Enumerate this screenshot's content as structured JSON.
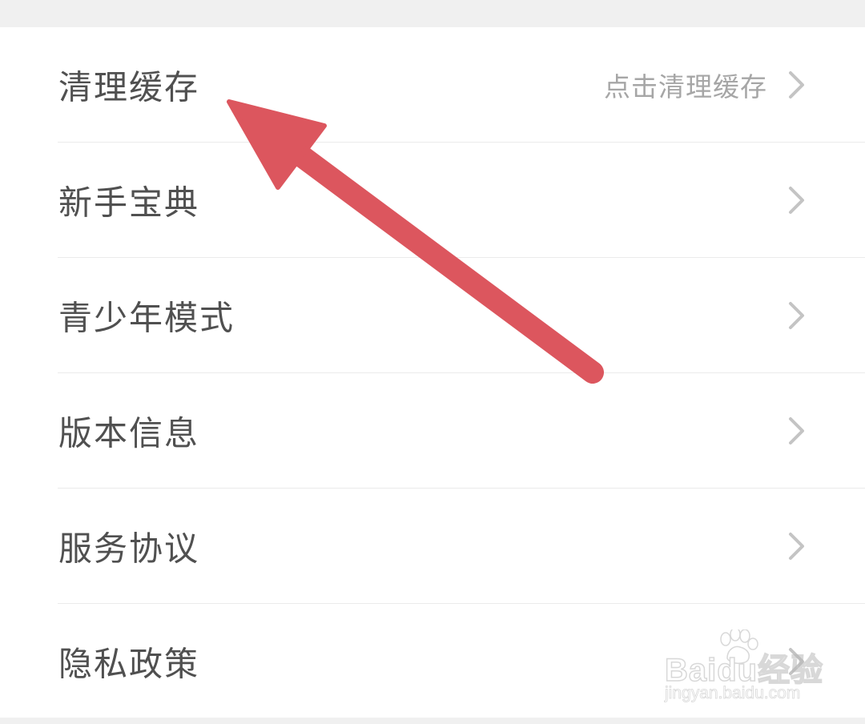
{
  "settings": {
    "items": [
      {
        "label": "清理缓存",
        "value": "点击清理缓存"
      },
      {
        "label": "新手宝典",
        "value": ""
      },
      {
        "label": "青少年模式",
        "value": ""
      },
      {
        "label": "版本信息",
        "value": ""
      },
      {
        "label": "服务协议",
        "value": ""
      },
      {
        "label": "隐私政策",
        "value": ""
      }
    ]
  },
  "icons": {
    "row_chevron": "chevron-right-icon",
    "annotation": "red-arrow-annotation"
  },
  "watermark": {
    "brand": "Baidu经验",
    "url": "jingyan.baidu.com"
  },
  "colors": {
    "background": "#f0f0f0",
    "card": "#ffffff",
    "label_text": "#505050",
    "value_text": "#a6a6a6",
    "chevron": "#c4c4c4",
    "arrow": "#dc565e"
  }
}
